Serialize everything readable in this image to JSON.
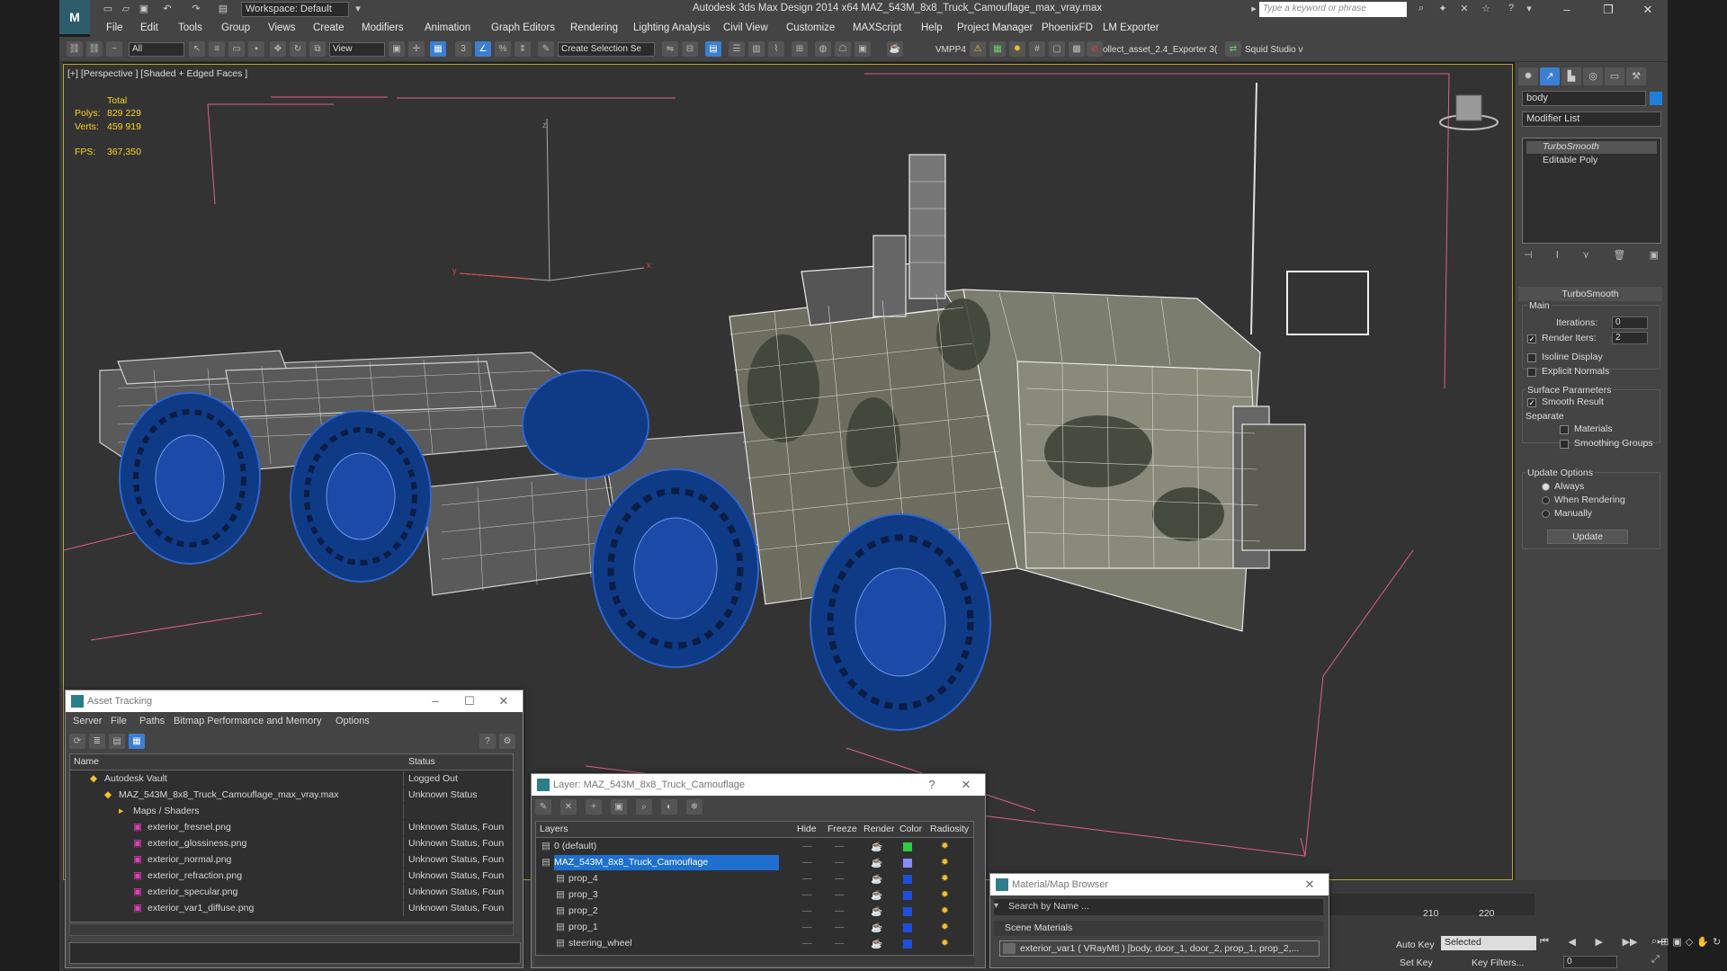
{
  "app": {
    "workspace": "Workspace: Default",
    "title": "Autodesk 3ds Max Design 2014 x64     MAZ_543M_8x8_Truck_Camouflage_max_vray.max",
    "search_placeholder": "Type a keyword or phrase"
  },
  "menu": [
    "File",
    "Edit",
    "Tools",
    "Group",
    "Views",
    "Create",
    "Modifiers",
    "Animation",
    "Graph Editors",
    "Rendering",
    "Lighting Analysis",
    "Civil View",
    "Customize",
    "MAXScript",
    "Help",
    "Project Manager",
    "PhoenixFD",
    "LM Exporter"
  ],
  "toolbar": {
    "filter": "All",
    "coord": "View",
    "selection_set": "Create Selection Se",
    "vmpp": "VMPP4",
    "exporter": "ollect_asset_2.4_Exporter  3(",
    "squid": "Squid Studio v"
  },
  "viewport": {
    "label": "[+] [Perspective ] [Shaded + Edged Faces ]",
    "stats": {
      "total_label": "Total",
      "polys_label": "Polys:",
      "polys": "829 229",
      "verts_label": "Verts:",
      "verts": "459 919",
      "fps_label": "FPS:",
      "fps": "367,350"
    },
    "axis": {
      "z": "z",
      "x": "x",
      "y": "y"
    }
  },
  "command_panel": {
    "object_name": "body",
    "modifier_list": "Modifier List",
    "stack": [
      "TurboSmooth",
      "Editable Poly"
    ],
    "rollout_title": "TurboSmooth",
    "main_label": "Main",
    "iterations_label": "Iterations:",
    "iterations": "0",
    "render_iters_label": "Render Iters:",
    "render_iters": "2",
    "isoline": "Isoline Display",
    "explicit_normals": "Explicit Normals",
    "surface_params": "Surface Parameters",
    "smooth_result": "Smooth Result",
    "separate": "Separate",
    "materials": "Materials",
    "smoothing_groups": "Smoothing Groups",
    "update_options": "Update Options",
    "always": "Always",
    "when_rendering": "When Rendering",
    "manually": "Manually",
    "update_btn": "Update"
  },
  "asset_tracking": {
    "title": "Asset Tracking",
    "menu": [
      "Server",
      "File",
      "Paths",
      "Bitmap Performance and Memory",
      "Options"
    ],
    "col_name": "Name",
    "col_status": "Status",
    "rows": [
      {
        "name": "Autodesk Vault",
        "status": "Logged Out",
        "indent": 0
      },
      {
        "name": "MAZ_543M_8x8_Truck_Camouflage_max_vray.max",
        "status": "Unknown Status",
        "indent": 1
      },
      {
        "name": "Maps / Shaders",
        "status": "",
        "indent": 2
      },
      {
        "name": "exterior_fresnel.png",
        "status": "Unknown Status, Foun",
        "indent": 3
      },
      {
        "name": "exterior_glossiness.png",
        "status": "Unknown Status, Foun",
        "indent": 3
      },
      {
        "name": "exterior_normal.png",
        "status": "Unknown Status, Foun",
        "indent": 3
      },
      {
        "name": "exterior_refraction.png",
        "status": "Unknown Status, Foun",
        "indent": 3
      },
      {
        "name": "exterior_specular.png",
        "status": "Unknown Status, Foun",
        "indent": 3
      },
      {
        "name": "exterior_var1_diffuse.png",
        "status": "Unknown Status, Foun",
        "indent": 3
      }
    ]
  },
  "layer_window": {
    "title": "Layer: MAZ_543M_8x8_Truck_Camouflage",
    "help": "?",
    "cols": [
      "Layers",
      "Hide",
      "Freeze",
      "Render",
      "Color",
      "Radiosity"
    ],
    "rows": [
      {
        "name": "0 (default)",
        "indent": 0,
        "color": "#2ecc40",
        "selected": false
      },
      {
        "name": "MAZ_543M_8x8_Truck_Camouflage",
        "indent": 0,
        "color": "#8a8aff",
        "selected": true
      },
      {
        "name": "prop_4",
        "indent": 1,
        "color": "#1f4fd8",
        "selected": false
      },
      {
        "name": "prop_3",
        "indent": 1,
        "color": "#1f4fd8",
        "selected": false
      },
      {
        "name": "prop_2",
        "indent": 1,
        "color": "#1f4fd8",
        "selected": false
      },
      {
        "name": "prop_1",
        "indent": 1,
        "color": "#1f4fd8",
        "selected": false
      },
      {
        "name": "steering_wheel",
        "indent": 1,
        "color": "#1f4fd8",
        "selected": false
      }
    ]
  },
  "material_browser": {
    "title": "Material/Map Browser",
    "search": "Search by Name ...",
    "section": "Scene Materials",
    "items": [
      "exterior_var1  ( VRayMtl ) [body, door_1, door_2, prop_1, prop_2,..."
    ]
  },
  "bottom": {
    "timeline_ticks": [
      "210",
      "220"
    ],
    "auto_key": "Auto Key",
    "set_key": "Set Key",
    "selected": "Selected",
    "key_filters": "Key Filters...",
    "frame": "0"
  }
}
